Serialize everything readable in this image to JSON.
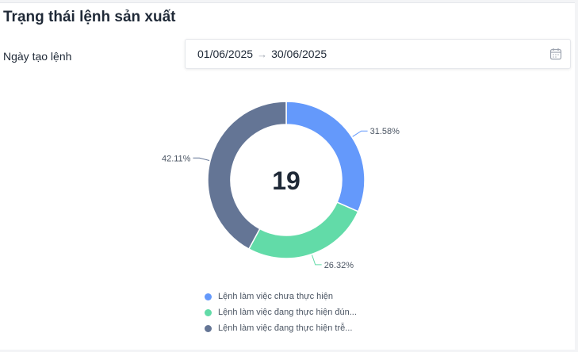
{
  "page": {
    "title": "Trạng thái lệnh sản xuất"
  },
  "filter": {
    "label": "Ngày tạo lệnh",
    "date_start": "01/06/2025",
    "arrow": "→",
    "date_end": "30/06/2025",
    "icon": "calendar-icon"
  },
  "colors": {
    "blue": "#6499fb",
    "green": "#62dba8",
    "slate": "#647595"
  },
  "chart_data": {
    "type": "pie",
    "variant": "donut",
    "center_label": "19",
    "slices": [
      {
        "label": "Lệnh làm việc chưa thực hiện",
        "value": 31.58,
        "value_label": "31.58%",
        "color": "#6499fb"
      },
      {
        "label": "Lệnh làm việc đang thực hiện đún...",
        "value": 26.32,
        "value_label": "26.32%",
        "color": "#62dba8"
      },
      {
        "label": "Lệnh làm việc đang thực hiện trễ...",
        "value": 42.11,
        "value_label": "42.11%",
        "color": "#647595"
      }
    ],
    "legend_position": "bottom"
  }
}
